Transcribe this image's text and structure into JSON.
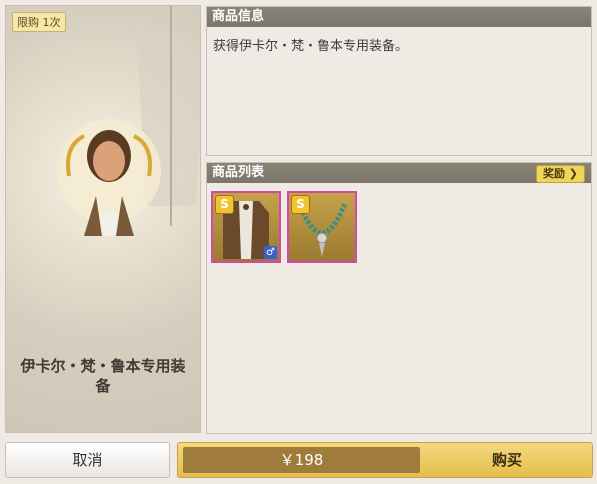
{
  "left_card": {
    "limit_badge": "限购 1次",
    "character_name": "伊卡尔・梵・鲁本专用装备"
  },
  "info_panel": {
    "title": "商品信息",
    "description": "获得伊卡尔・梵・鲁本专用装备。"
  },
  "list_panel": {
    "title": "商品列表",
    "reward_button": "奖励 ❯",
    "items": [
      {
        "rank": "S",
        "gender": "♂"
      },
      {
        "rank": "S"
      }
    ]
  },
  "footer": {
    "cancel_label": "取消",
    "price": "￥198",
    "buy_label": "购买"
  },
  "colors": {
    "accent": "#f1d35a",
    "item_border": "#d448a8",
    "header": "#7c766a"
  }
}
